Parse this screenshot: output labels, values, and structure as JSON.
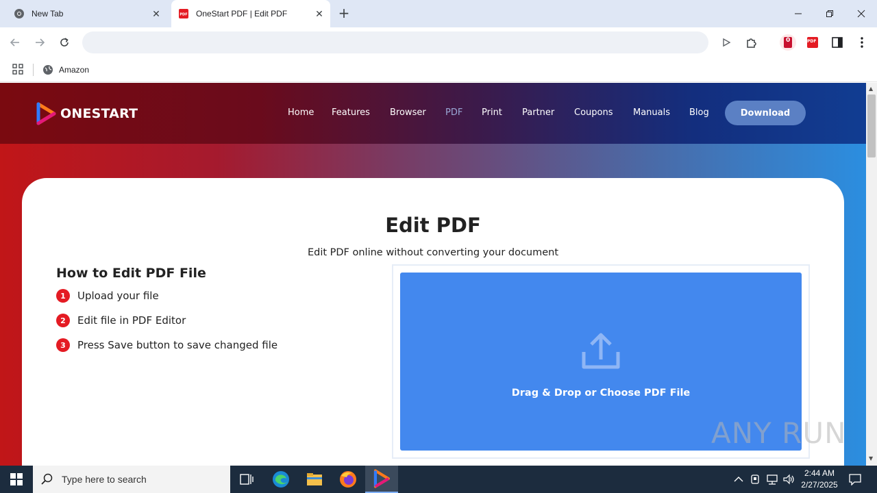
{
  "browser": {
    "tabs": [
      {
        "title": "New Tab"
      },
      {
        "title": "OneStart PDF | Edit PDF"
      }
    ],
    "address": "",
    "bookmarks": [
      {
        "label": "Amazon"
      }
    ],
    "extension_badge": "0",
    "pdf_ext_label": "PDF"
  },
  "site": {
    "logo": "ONESTART",
    "nav": [
      "Home",
      "Features",
      "Browser",
      "PDF",
      "Print",
      "Partner",
      "Coupons",
      "Manuals",
      "Blog"
    ],
    "active_nav": "PDF",
    "download": "Download",
    "title": "Edit PDF",
    "subtitle": "Edit PDF online without converting your document",
    "howto_title": "How to Edit PDF File",
    "steps": [
      {
        "num": "1",
        "text": "Upload your file"
      },
      {
        "num": "2",
        "text": "Edit file in PDF Editor"
      },
      {
        "num": "3",
        "text": "Press Save button to save changed file"
      }
    ],
    "dropzone": "Drag & Drop or Choose PDF File"
  },
  "watermark": "ANY RUN",
  "taskbar": {
    "search_placeholder": "Type here to search",
    "time": "2:44 AM",
    "date": "2/27/2025"
  },
  "colors": {
    "accent_red": "#e41b23",
    "dropzone_blue": "#4388ee",
    "download_btn": "#5b80c4"
  }
}
